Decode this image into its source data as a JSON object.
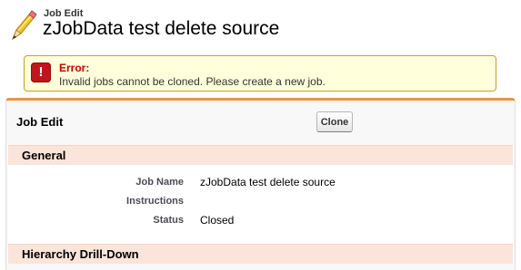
{
  "header": {
    "subtitle": "Job Edit",
    "title": "zJobData test delete source",
    "icon": "pencil-icon"
  },
  "error": {
    "icon": "exclamation-icon",
    "heading": "Error:",
    "message": "Invalid jobs cannot be cloned. Please create a new job."
  },
  "panel": {
    "title": "Job Edit",
    "clone_label": "Clone"
  },
  "sections": {
    "general": {
      "title": "General",
      "fields": [
        {
          "label": "Job Name",
          "value": "zJobData test delete source"
        },
        {
          "label": "Instructions",
          "value": ""
        },
        {
          "label": "Status",
          "value": "Closed"
        }
      ]
    },
    "hierarchy": {
      "title": "Hierarchy Drill-Down"
    }
  },
  "colors": {
    "accent": "#e1974d",
    "section_bg": "#fbe4d9",
    "error_bg": "#ffffdc",
    "error_border": "#c69f2e",
    "error_text": "#c00000"
  }
}
